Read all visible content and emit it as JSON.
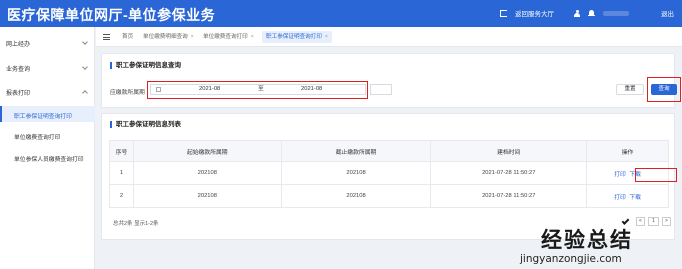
{
  "header": {
    "title": "医疗保障单位网厅-单位参保业务",
    "return_label": "返回服务大厅",
    "logout_label": "退出"
  },
  "sidebar": {
    "items": [
      {
        "label": "网上经办"
      },
      {
        "label": "业务查询"
      },
      {
        "label": "报表打印"
      }
    ],
    "sub_items": [
      {
        "label": "职工参保证明查询打印"
      },
      {
        "label": "单位缴费查询打印"
      },
      {
        "label": "单位参保人员缴费查询打印"
      }
    ]
  },
  "tabs": [
    {
      "label": "首页"
    },
    {
      "label": "单位缴费明细查询"
    },
    {
      "label": "单位缴费查询打印"
    },
    {
      "label": "职工参保证明查询打印"
    }
  ],
  "query_panel": {
    "title": "职工参保证明信息查询",
    "period_label": "应缴款所属期",
    "start_value": "2021-08",
    "to_label": "至",
    "end_value": "2021-08",
    "reset_label": "重置",
    "query_label": "查询"
  },
  "list_panel": {
    "title": "职工参保证明信息列表",
    "columns": [
      "序号",
      "起始缴款所属期",
      "截止缴款所属期",
      "建档时间",
      "操作"
    ],
    "rows": [
      {
        "no": "1",
        "start": "202108",
        "end": "202108",
        "time": "2021-07-28 11:50:27",
        "print": "打印",
        "download": "下载"
      },
      {
        "no": "2",
        "start": "202108",
        "end": "202108",
        "time": "2021-07-28 11:50:27",
        "print": "打印",
        "download": "下载"
      }
    ],
    "footer": "总共2条 显示1-2条",
    "page_number": "1",
    "page_prev": "<",
    "page_next": ">"
  },
  "watermark": {
    "chars": "经验总结",
    "url": "jingyanzongjie.com"
  },
  "colors": {
    "primary": "#2a66d6",
    "highlight": "#e02020"
  }
}
